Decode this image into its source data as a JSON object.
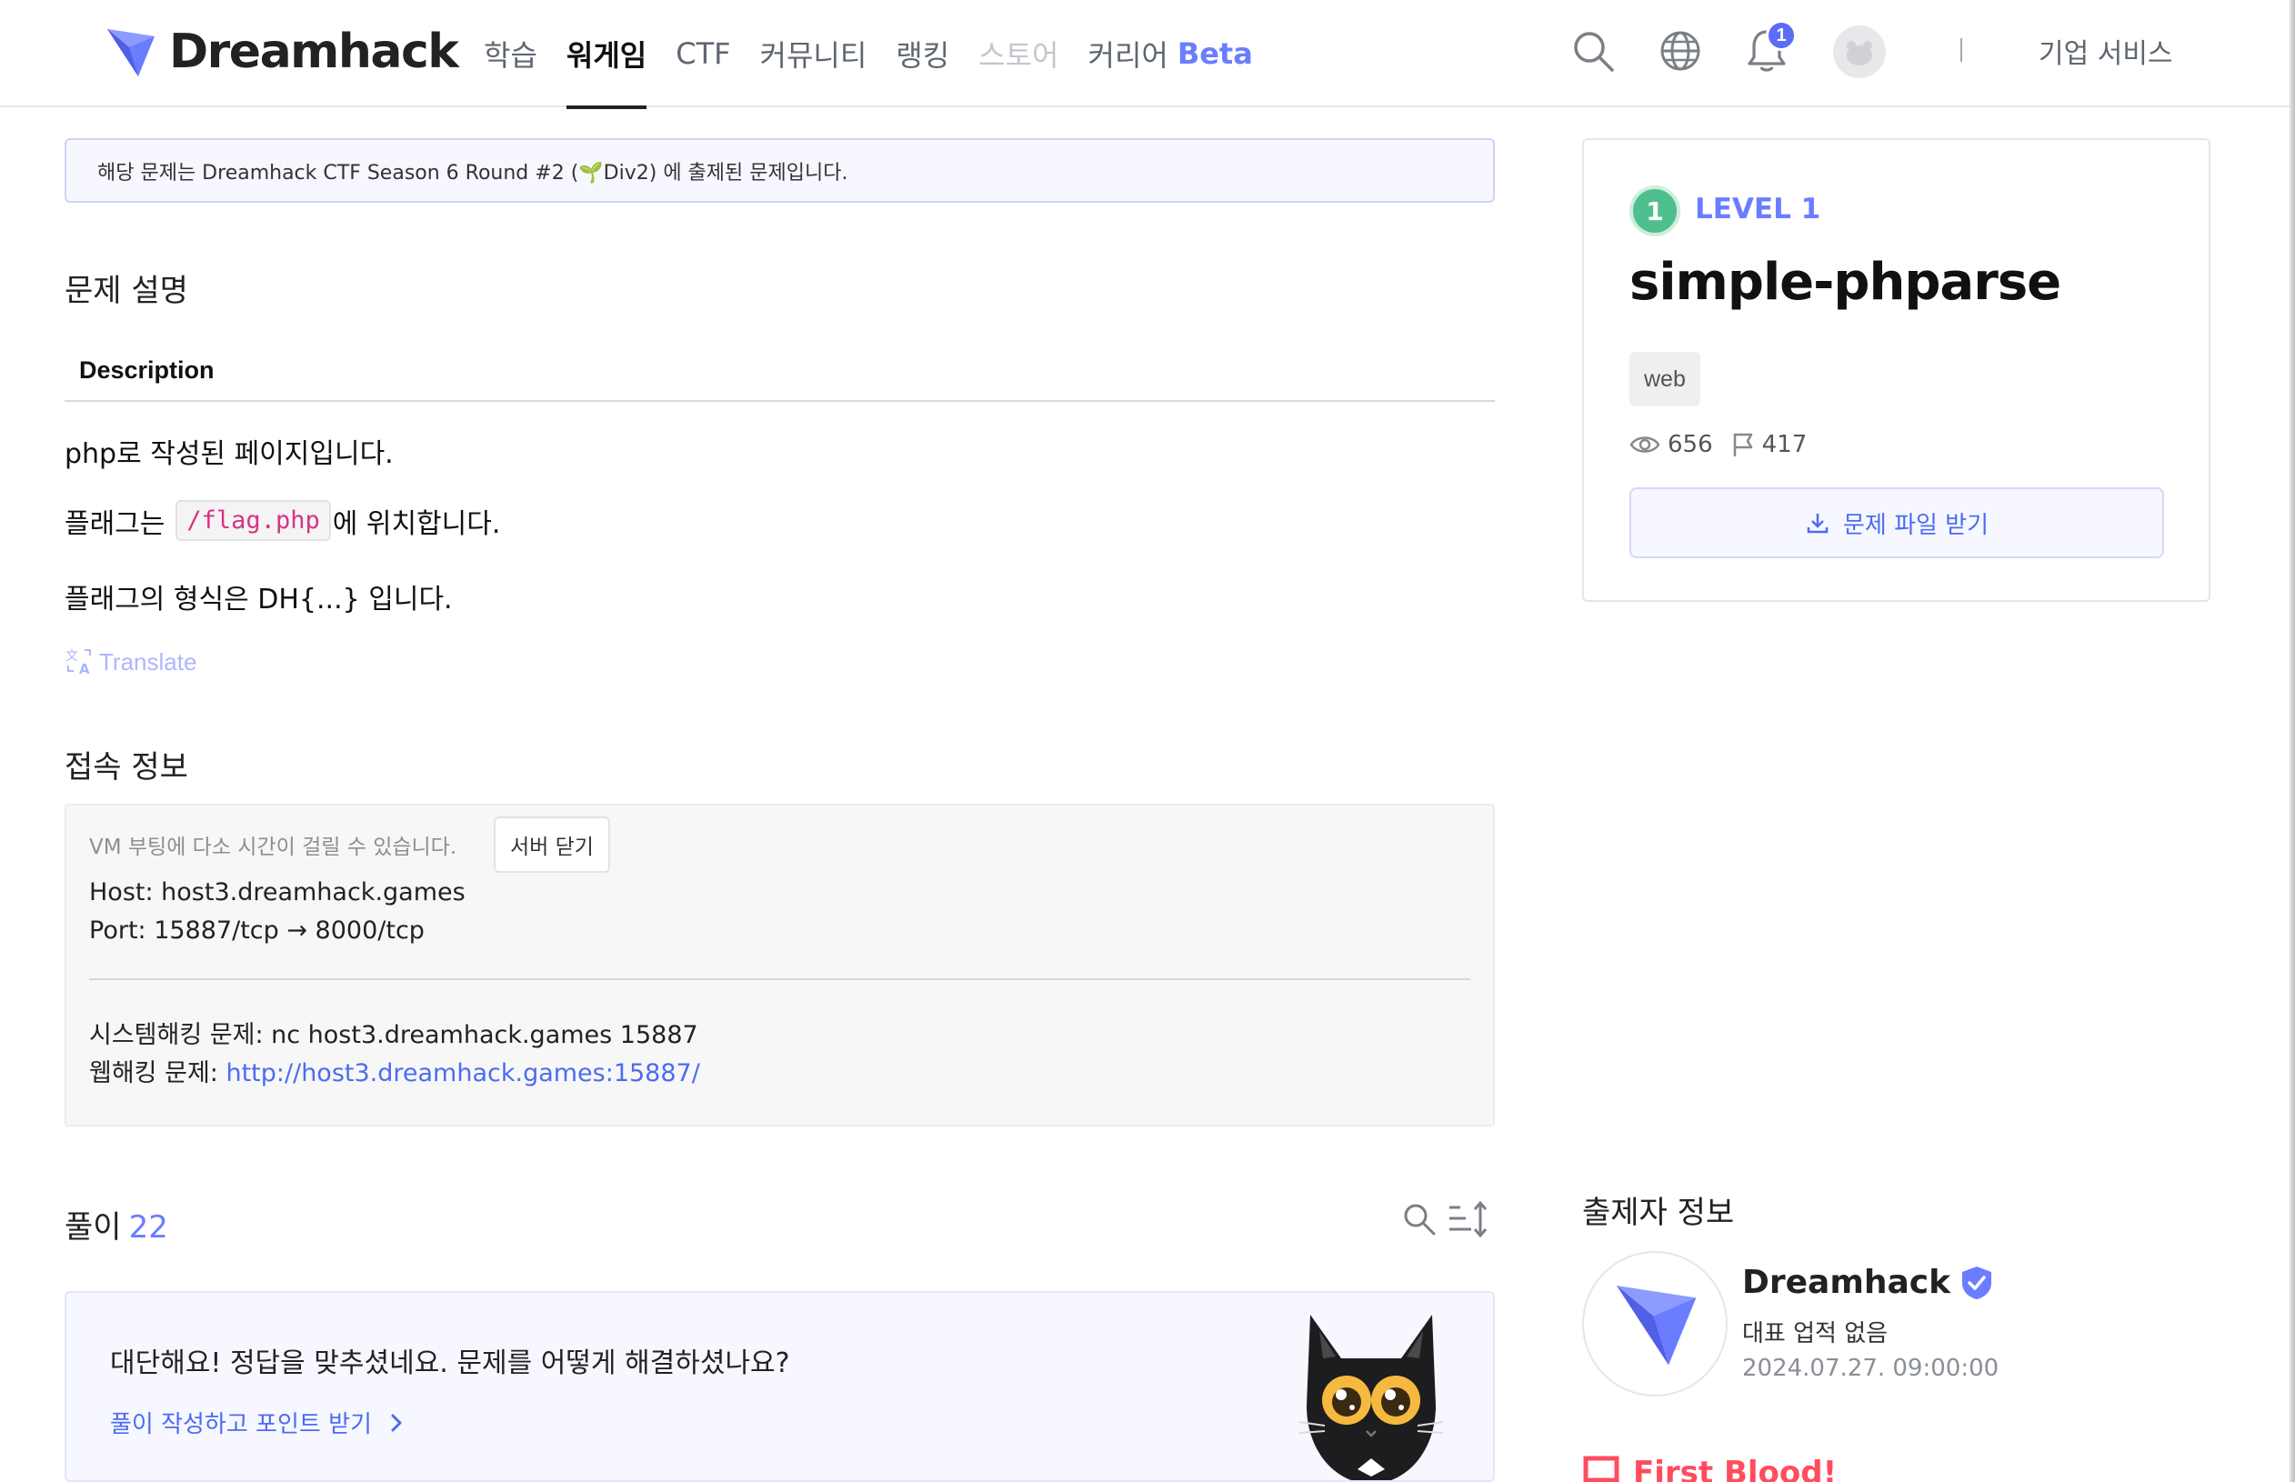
{
  "header": {
    "logo_text": "Dreamhack",
    "nav": [
      {
        "label": "학습"
      },
      {
        "label": "워게임"
      },
      {
        "label": "CTF"
      },
      {
        "label": "커뮤니티"
      },
      {
        "label": "랭킹"
      },
      {
        "label": "스토어"
      },
      {
        "label": "커리어",
        "suffix": "Beta"
      }
    ],
    "notification_count": "1",
    "separator": "|",
    "business_label": "기업 서비스"
  },
  "notice": "해당 문제는 Dreamhack CTF Season 6 Round #2 (🌱Div2) 에 출제된 문제입니다.",
  "description": {
    "section_title": "문제 설명",
    "heading": "Description",
    "line1": "php로 작성된 페이지입니다.",
    "line2_prefix": "플래그는",
    "line2_code": "/flag.php",
    "line2_suffix": "에 위치합니다.",
    "line3": "플래그의 형식은 DH{...} 입니다.",
    "translate_label": "Translate"
  },
  "connection": {
    "section_title": "접속 정보",
    "vm_note": "VM 부팅에 다소 시간이 걸릴 수 있습니다.",
    "close_button": "서버 닫기",
    "host": "Host: host3.dreamhack.games",
    "port": "Port:  15887/tcp → 8000/tcp",
    "system_label": "시스템해킹 문제: nc host3.dreamhack.games 15887",
    "web_label": "웹해킹 문제:",
    "web_url": "http://host3.dreamhack.games:15887/"
  },
  "solutions": {
    "title": "풀이",
    "count": "22",
    "message": "대단해요! 정답을 맞추셨네요. 문제를 어떻게 해결하셨나요?",
    "write_link": "풀이 작성하고 포인트 받기"
  },
  "challenge": {
    "level_number": "1",
    "level_label": "LEVEL 1",
    "title": "simple-phparse",
    "tag": "web",
    "views": "656",
    "solves": "417",
    "download_label": "문제 파일 받기"
  },
  "author": {
    "section_title": "출제자 정보",
    "name": "Dreamhack",
    "achievement": "대표 업적 없음",
    "date": "2024.07.27. 09:00:00"
  },
  "first_blood": {
    "label": "First Blood!"
  },
  "colors": {
    "accent": "#6b7dff",
    "link": "#4c6cf0",
    "level_green": "#4fc08d",
    "first_blood": "#ff4d5e"
  },
  "icons": {
    "logo": "dreamhack-logo-icon",
    "search": "search-icon",
    "globe": "globe-icon",
    "bell": "bell-icon",
    "eye": "eye-icon",
    "flag": "flag-icon",
    "download": "download-icon",
    "translate": "translate-icon",
    "sort": "sort-icon",
    "chevron": "chevron-right-icon",
    "verified": "verified-badge-icon"
  }
}
